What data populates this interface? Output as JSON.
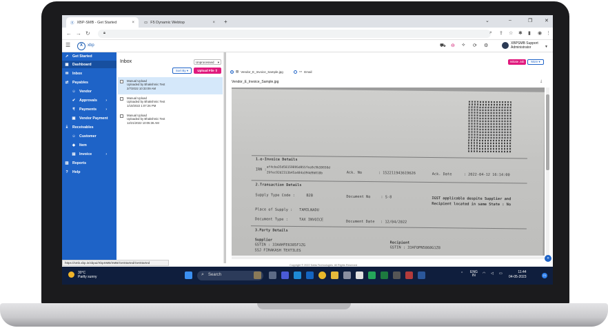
{
  "browser": {
    "tabs": [
      {
        "label": "XBP-SMB - Get Started"
      },
      {
        "label": "F5 Dynamic Webtop"
      }
    ],
    "new_tab": "+",
    "win_min": "–",
    "win_max": "❐",
    "win_close": "✕"
  },
  "app": {
    "logo_letter": "X",
    "logo_text": "xbp",
    "user_name": "XBPSMB Support",
    "user_role": "Administrator"
  },
  "sidebar": {
    "items": [
      {
        "label": "Get Started",
        "icon": "rocket-icon"
      },
      {
        "label": "Dashboard",
        "icon": "dashboard-icon"
      },
      {
        "label": "Inbox",
        "icon": "inbox-icon"
      },
      {
        "label": "Payables",
        "icon": "payables-icon"
      },
      {
        "label": "Vendor",
        "icon": "vendor-icon"
      },
      {
        "label": "Approvals",
        "icon": "approvals-icon"
      },
      {
        "label": "Payments",
        "icon": "payments-icon"
      },
      {
        "label": "Vendor Payment",
        "icon": "vendor-payment-icon"
      },
      {
        "label": "Receivables",
        "icon": "receivables-icon"
      },
      {
        "label": "Customer",
        "icon": "customer-icon"
      },
      {
        "label": "Item",
        "icon": "item-icon"
      },
      {
        "label": "Invoice",
        "icon": "invoice-icon"
      },
      {
        "label": "Reports",
        "icon": "reports-icon"
      },
      {
        "label": "Help",
        "icon": "help-icon"
      }
    ]
  },
  "inbox": {
    "title": "Inbox",
    "filter_value": "Unprocessed",
    "sort_label": "Sort By",
    "upload_label": "Upload File",
    "items": [
      {
        "title": "Manual Upload",
        "by": "Uploaded by Bhakshmic Test",
        "date": "2/7/2022 10:33:09 AM"
      },
      {
        "title": "Manual Upload",
        "by": "Uploaded by Bhakshmic Test",
        "date": "1/10/2022 1:07:26 PM"
      },
      {
        "title": "Manual Upload",
        "by": "Uploaded by Bhakshmic Test",
        "date": "12/21/2022 10:05:36 AM"
      }
    ]
  },
  "viewer": {
    "action_label": "Initiate Job",
    "more_label": "More",
    "radio_file": "Vendor_E_Invoice_Sample.jpg",
    "radio_email": "Email",
    "file_name": "Vendor_E_Invoice_Sample.jpg",
    "doc": {
      "s1": "1.e-Invoice Details",
      "irn_label": "IRN :",
      "irn_1": "af4cba35d58159895d055fea9c9b38650d",
      "irn_2": "29fec92d2313b45a484a394d9b018b",
      "ack_no_label": "Ack. No",
      "ack_no_val": ": 152211943619626",
      "ack_date_label": "Ack. Date",
      "ack_date_val": ": 2022-04-12 16:14:00",
      "s2": "2.Transaction Details",
      "supply_type_label": "Supply Type Code :",
      "supply_type_val": "B2B",
      "doc_no_label": "Document No",
      "doc_no_val": ": S-8",
      "igst_1": "IGST applicable despite Supplier and",
      "igst_2": "Recipient located in same State : No",
      "place_label": "Place of Supply :",
      "place_val": "TAMILNADU",
      "doc_type_label": "Document Type :",
      "doc_type_val": "TAX INVOICE",
      "doc_date_label": "Document Date",
      "doc_date_val": ": 12/04/2022",
      "s3": "3.Party Details",
      "supplier_label": "Supplier",
      "supplier_gstin": "GSTIN : 33AAHFE6385F1ZG",
      "supplier_name": "SSJ FIRAKASH TEXTILES",
      "recipient_label": "Recipient",
      "recipient_gstin": "GSTIN : 33AFOPN5868G1Z8"
    }
  },
  "status_url": "https://smb.xbp.in/xbpui/XbpSMB/SMB/GetStarted/GetStarted",
  "copyright": "Copyright © 2022 Datta Technologies. All Rights Reserved",
  "taskbar": {
    "temp": "30°C",
    "weather": "Partly sunny",
    "search": "Search",
    "lang": "ENG",
    "region": "IN",
    "time": "11:44",
    "date": "04-05-2023",
    "notif_count": "21"
  }
}
